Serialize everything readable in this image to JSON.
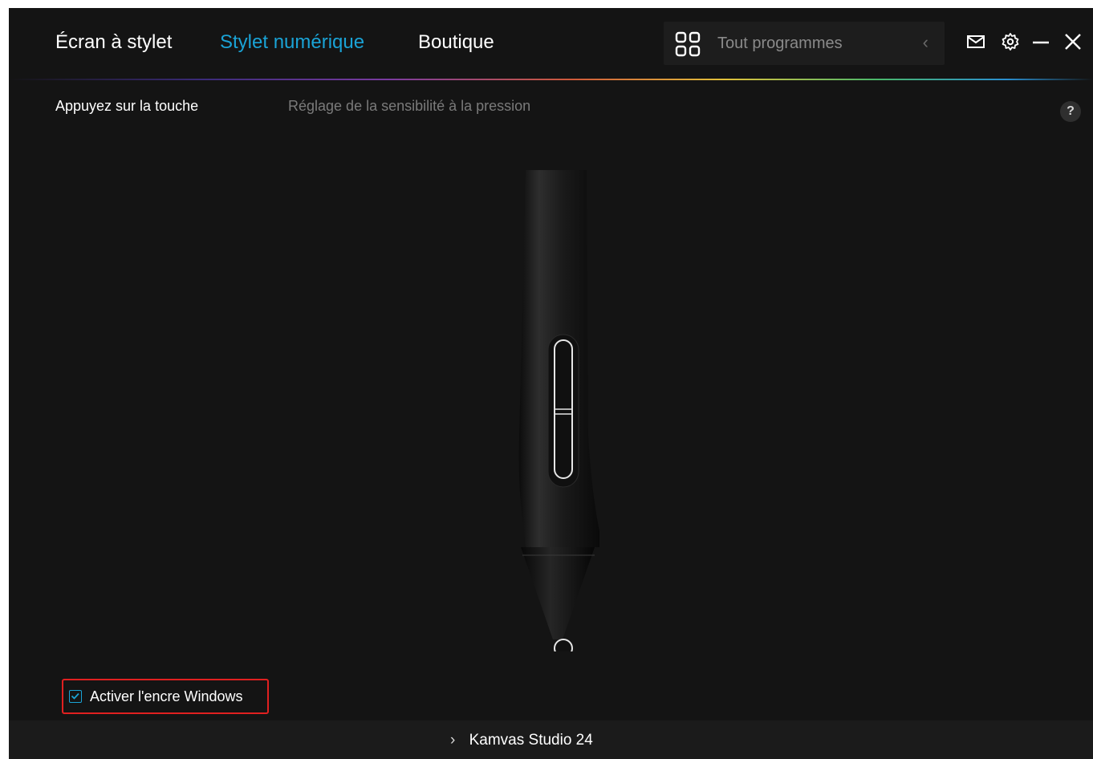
{
  "header": {
    "tabs": [
      {
        "label": "Écran à stylet",
        "active": false
      },
      {
        "label": "Stylet numérique",
        "active": true
      },
      {
        "label": "Boutique",
        "active": false
      }
    ],
    "program_selector": {
      "placeholder": "Tout programmes",
      "icon": "grid-icon",
      "back_icon": "chevron-left-icon"
    },
    "actions": [
      "mail-icon",
      "gear-icon",
      "minimize-icon",
      "close-icon"
    ]
  },
  "subnav": {
    "items": [
      {
        "label": "Appuyez sur la touche",
        "active": true
      },
      {
        "label": "Réglage de la sensibilité à la pression",
        "active": false
      }
    ],
    "help_label": "?"
  },
  "options": {
    "windows_ink_label": "Activer l'encre Windows",
    "windows_ink_checked": true
  },
  "footer": {
    "device_label": "Kamvas Studio 24",
    "chevron": "chevron-right-icon"
  },
  "colors": {
    "accent": "#1aa3d6",
    "background": "#141414",
    "highlight_border": "#e02020"
  }
}
